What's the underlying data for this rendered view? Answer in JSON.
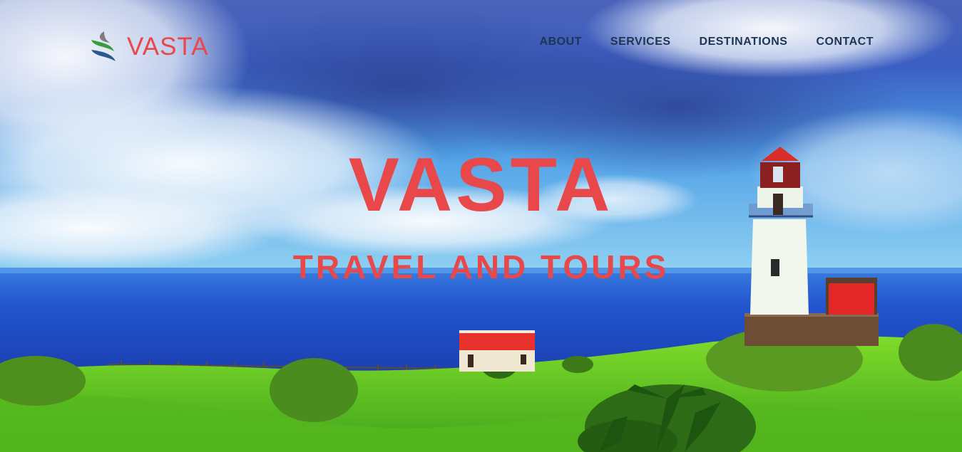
{
  "brand": {
    "name": "VASTA",
    "logo_icon": "leaf-wave-logo-icon"
  },
  "nav": {
    "items": [
      {
        "label": "ABOUT"
      },
      {
        "label": "SERVICES"
      },
      {
        "label": "DESTINATIONS"
      },
      {
        "label": "CONTACT"
      }
    ]
  },
  "hero": {
    "title": "VASTA",
    "subtitle": "TRAVEL AND TOURS",
    "background": "lighthouse-seascape-photo"
  },
  "colors": {
    "accent": "#e8484a",
    "nav_text": "#1d3553",
    "logo_green": "#3a9a3c",
    "logo_blue": "#2a5a8c",
    "logo_gray": "#7d7d7d"
  }
}
